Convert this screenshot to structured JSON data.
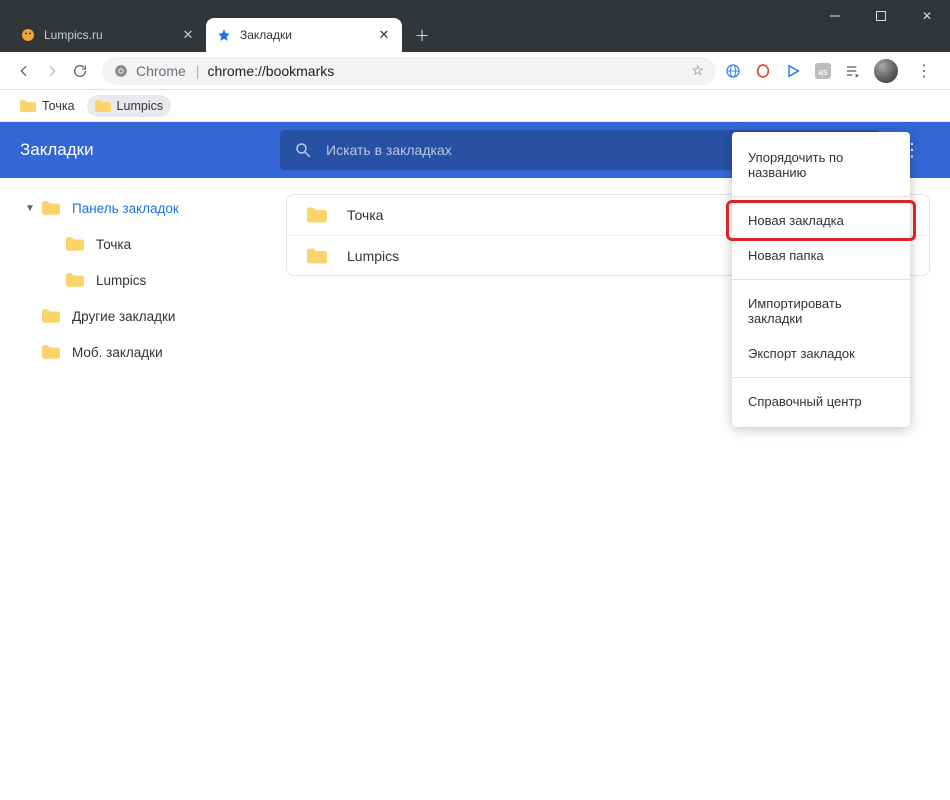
{
  "window": {
    "tabs": [
      {
        "label": "Lumpics.ru",
        "active": false
      },
      {
        "label": "Закладки",
        "active": true
      }
    ]
  },
  "omnibox": {
    "scheme": "Chrome",
    "path": "chrome://bookmarks"
  },
  "bookmarks_bar": {
    "items": [
      {
        "label": "Точка"
      },
      {
        "label": "Lumpics"
      }
    ]
  },
  "bm_header": {
    "title": "Закладки",
    "search_placeholder": "Искать в закладках"
  },
  "sidebar": {
    "tree": [
      {
        "label": "Панель закладок",
        "level": 0,
        "selected": true,
        "expandable": true,
        "children": [
          {
            "label": "Точка",
            "level": 1
          },
          {
            "label": "Lumpics",
            "level": 1
          }
        ]
      },
      {
        "label": "Другие закладки",
        "level": 0
      },
      {
        "label": "Моб. закладки",
        "level": 0
      }
    ]
  },
  "list": [
    {
      "label": "Точка"
    },
    {
      "label": "Lumpics"
    }
  ],
  "context_menu": {
    "sort": "Упорядочить по названию",
    "new_bookmark": "Новая закладка",
    "new_folder": "Новая папка",
    "import": "Импортировать закладки",
    "export": "Экспорт закладок",
    "help": "Справочный центр"
  }
}
